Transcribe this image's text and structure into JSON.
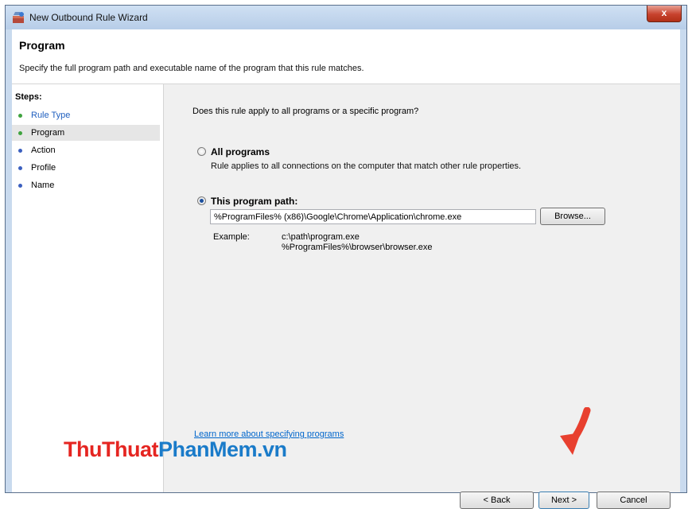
{
  "window": {
    "title": "New Outbound Rule Wizard",
    "close_label": "x"
  },
  "header": {
    "title": "Program",
    "description": "Specify the full program path and executable name of the program that this rule matches."
  },
  "steps": {
    "title": "Steps:",
    "items": [
      {
        "label": "Rule Type",
        "state": "completed",
        "dot_color": "#3fa33f",
        "text_color": "#1f5fbf"
      },
      {
        "label": "Program",
        "state": "current",
        "dot_color": "#3fa33f",
        "text_color": "#000000"
      },
      {
        "label": "Action",
        "state": "pending",
        "dot_color": "#3b5fbf",
        "text_color": "#000000"
      },
      {
        "label": "Profile",
        "state": "pending",
        "dot_color": "#3b5fbf",
        "text_color": "#000000"
      },
      {
        "label": "Name",
        "state": "pending",
        "dot_color": "#3b5fbf",
        "text_color": "#000000"
      }
    ]
  },
  "main": {
    "question": "Does this rule apply to all programs or a specific program?",
    "all_programs": {
      "label": "All programs",
      "description": "Rule applies to all connections on the computer that match other rule properties.",
      "checked": false
    },
    "program_path": {
      "label": "This program path:",
      "checked": true,
      "value": "%ProgramFiles% (x86)\\Google\\Chrome\\Application\\chrome.exe"
    },
    "browse_label": "Browse...",
    "example_label": "Example:",
    "example_values": [
      "c:\\path\\program.exe",
      "%ProgramFiles%\\browser\\browser.exe"
    ],
    "learn_more_link": "Learn more about specifying programs"
  },
  "footer": {
    "back_label": "< Back",
    "next_label": "Next >",
    "cancel_label": "Cancel"
  },
  "watermark": {
    "part1": "ThuThuat",
    "part2": "PhanMem",
    "part3": ".vn"
  },
  "colors": {
    "accent_arrow": "#e8402f",
    "link": "#0066cc"
  }
}
